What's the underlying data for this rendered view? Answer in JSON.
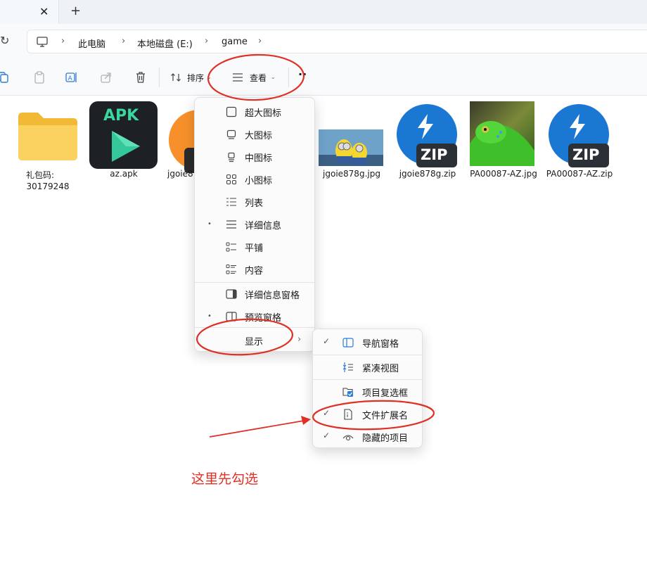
{
  "titlebar": {
    "close_glyph": "✕",
    "new_tab_glyph": "+"
  },
  "addressbar": {
    "refresh_glyph": "↻",
    "crumbs": [
      "此电脑",
      "本地磁盘 (E:)",
      "game"
    ],
    "separator": "›"
  },
  "toolbar": {
    "icons": [
      "copy-icon",
      "paste-icon",
      "rename-icon",
      "share-icon",
      "delete-icon"
    ],
    "sort_label": "排序",
    "view_label": "查看",
    "more_label": "··"
  },
  "files": [
    {
      "name_line1": "礼包码:",
      "name_line2": "30179248",
      "icon": "folder-icon"
    },
    {
      "name": "az.apk",
      "icon": "apk-icon",
      "badge": "APK"
    },
    {
      "name": "jgoie87",
      "icon": "zip-icon"
    },
    {
      "name": "jgoie878g.jpg",
      "icon": "image-thumbnail"
    },
    {
      "name": "jgoie878g.zip",
      "icon": "zip-icon",
      "badge": "ZIP"
    },
    {
      "name": "PA00087-AZ.jpg",
      "icon": "image-thumbnail"
    },
    {
      "name": "PA00087-AZ.zip",
      "icon": "zip-icon",
      "badge": "ZIP"
    }
  ],
  "view_menu": {
    "items": [
      {
        "label": "超大图标",
        "icon": "extra-large-icons-icon",
        "selected": false
      },
      {
        "label": "大图标",
        "icon": "large-icons-icon",
        "selected": false
      },
      {
        "label": "中图标",
        "icon": "medium-icons-icon",
        "selected": false
      },
      {
        "label": "小图标",
        "icon": "small-icons-icon",
        "selected": false
      },
      {
        "label": "列表",
        "icon": "list-icon",
        "selected": false
      },
      {
        "label": "详细信息",
        "icon": "details-icon",
        "selected": true
      },
      {
        "label": "平铺",
        "icon": "tiles-icon",
        "selected": false
      },
      {
        "label": "内容",
        "icon": "content-icon",
        "selected": false
      },
      {
        "label": "详细信息窗格",
        "icon": "details-pane-icon",
        "selected": false
      },
      {
        "label": "预览窗格",
        "icon": "preview-pane-icon",
        "selected": true
      }
    ],
    "show_label": "显示",
    "selected_marker": "•",
    "submenu_arrow": "›"
  },
  "show_submenu": {
    "items": [
      {
        "label": "导航窗格",
        "icon": "navigation-pane-icon",
        "checked": true
      },
      {
        "label": "紧凑视图",
        "icon": "compact-view-icon",
        "checked": false
      },
      {
        "label": "项目复选框",
        "icon": "item-checkbox-icon",
        "checked": false
      },
      {
        "label": "文件扩展名",
        "icon": "file-extension-icon",
        "checked": true
      },
      {
        "label": "隐藏的项目",
        "icon": "hidden-items-icon",
        "checked": true
      }
    ],
    "check_marker": "✓"
  },
  "annotation": {
    "text": "这里先勾选",
    "color": "#e03025"
  },
  "colors": {
    "annotation_red": "#e03025",
    "folder_yellow": "#f6c33d",
    "zip_blue": "#1a77d2",
    "apk_green": "#34c79a"
  }
}
